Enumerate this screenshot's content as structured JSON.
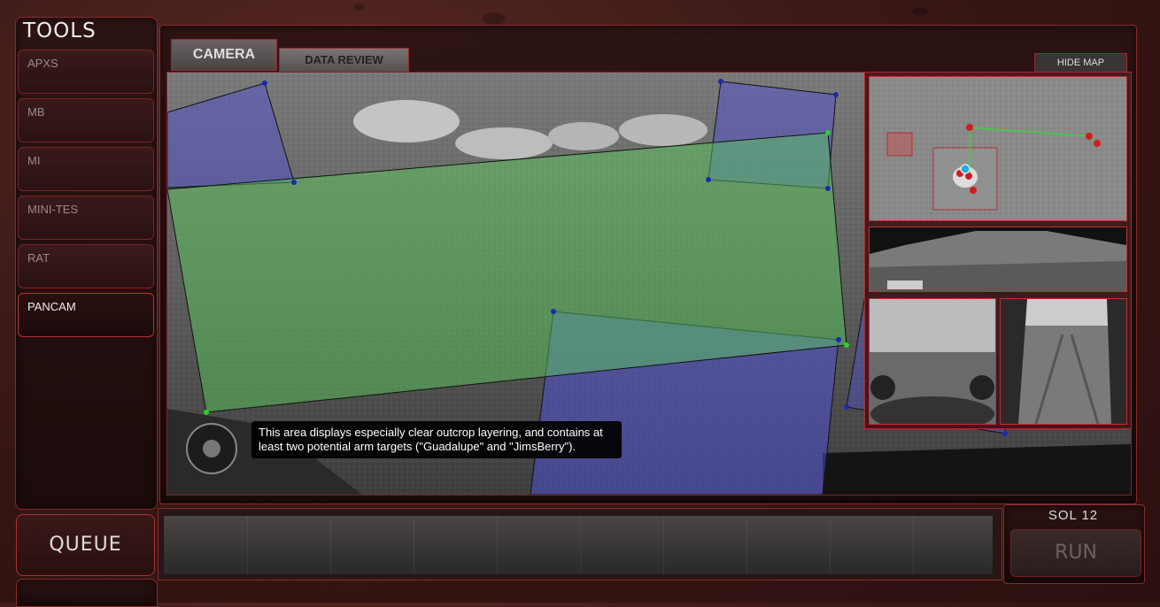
{
  "tools": {
    "title": "TOOLS",
    "items": [
      {
        "label": "APXS"
      },
      {
        "label": "MB"
      },
      {
        "label": "MI"
      },
      {
        "label": "MINI-TES"
      },
      {
        "label": "RAT"
      },
      {
        "label": "PANCAM"
      }
    ],
    "active": "PANCAM"
  },
  "tabs": {
    "camera": "CAMERA",
    "data_review": "DATA REVIEW",
    "active": "CAMERA"
  },
  "map": {
    "hide_label": "HIDE MAP"
  },
  "camera": {
    "tooltip": "This area displays especially clear outcrop layering, and contains at least two potential arm targets (\"Guadalupe\" and \"JimsBerry\")."
  },
  "queue": {
    "label": "QUEUE"
  },
  "run": {
    "sol": "SOL 12",
    "label": "RUN"
  },
  "colors": {
    "frame_red": "#9a2a2a",
    "region_green": "#5ad45a",
    "region_blue": "#5a5ad4",
    "marker_red": "#d21c1c",
    "marker_blue": "#2aa8e0"
  }
}
